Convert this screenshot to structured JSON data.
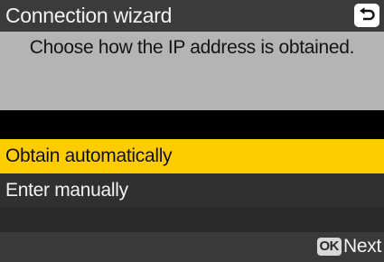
{
  "header": {
    "title": "Connection wizard",
    "back_icon": "return-arrow-icon"
  },
  "prompt": {
    "text": "Choose how the IP address is obtained."
  },
  "options": [
    {
      "label": "Obtain automatically",
      "selected": true
    },
    {
      "label": "Enter manually",
      "selected": false
    }
  ],
  "footer": {
    "ok_badge": "OK",
    "next_label": "Next"
  },
  "colors": {
    "highlight": "#ffcc00",
    "title_bar": "#3b3b3b",
    "prompt_bg": "#b4b4b4"
  }
}
